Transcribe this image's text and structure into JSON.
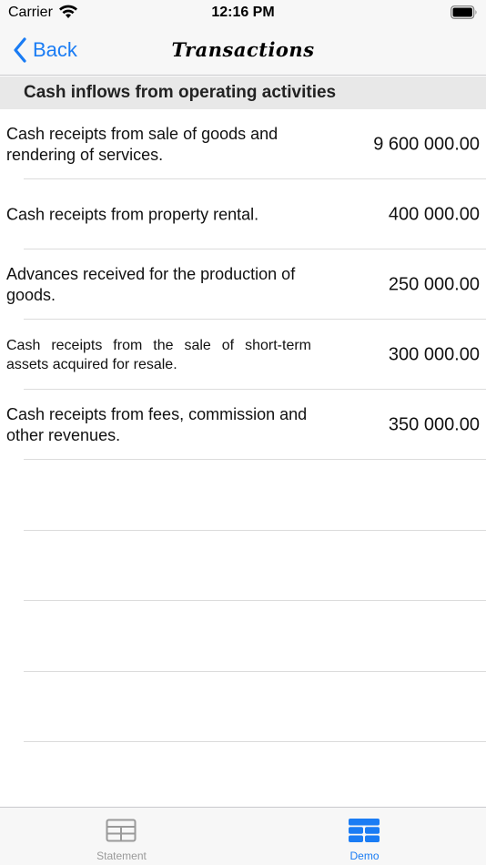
{
  "status_bar": {
    "carrier": "Carrier",
    "time": "12:16 PM"
  },
  "nav": {
    "back_label": "Back",
    "title": "Transactions"
  },
  "section": {
    "title": "Cash inflows from operating activities"
  },
  "rows": [
    {
      "label": "Cash receipts from sale of goods and rendering of services.",
      "value": "9 600 000.00"
    },
    {
      "label": "Cash receipts from property rental.",
      "value": "400 000.00"
    },
    {
      "label": "Advances received for the production of goods.",
      "value": "250 000.00"
    },
    {
      "label": "Cash receipts from the sale of short-term assets acquired for resale.",
      "value": "300 000.00"
    },
    {
      "label": "Cash receipts from fees, commission and other revenues.",
      "value": "350 000.00"
    }
  ],
  "tabs": [
    {
      "label": "Statement",
      "icon": "table-grid-icon",
      "selected": false
    },
    {
      "label": "Demo",
      "icon": "list-blocks-icon",
      "selected": true
    }
  ],
  "colors": {
    "accent": "#1a7cf4",
    "inactive": "#9a9a9a",
    "bar_background": "#f7f7f7",
    "section_background": "#e8e8e8"
  }
}
